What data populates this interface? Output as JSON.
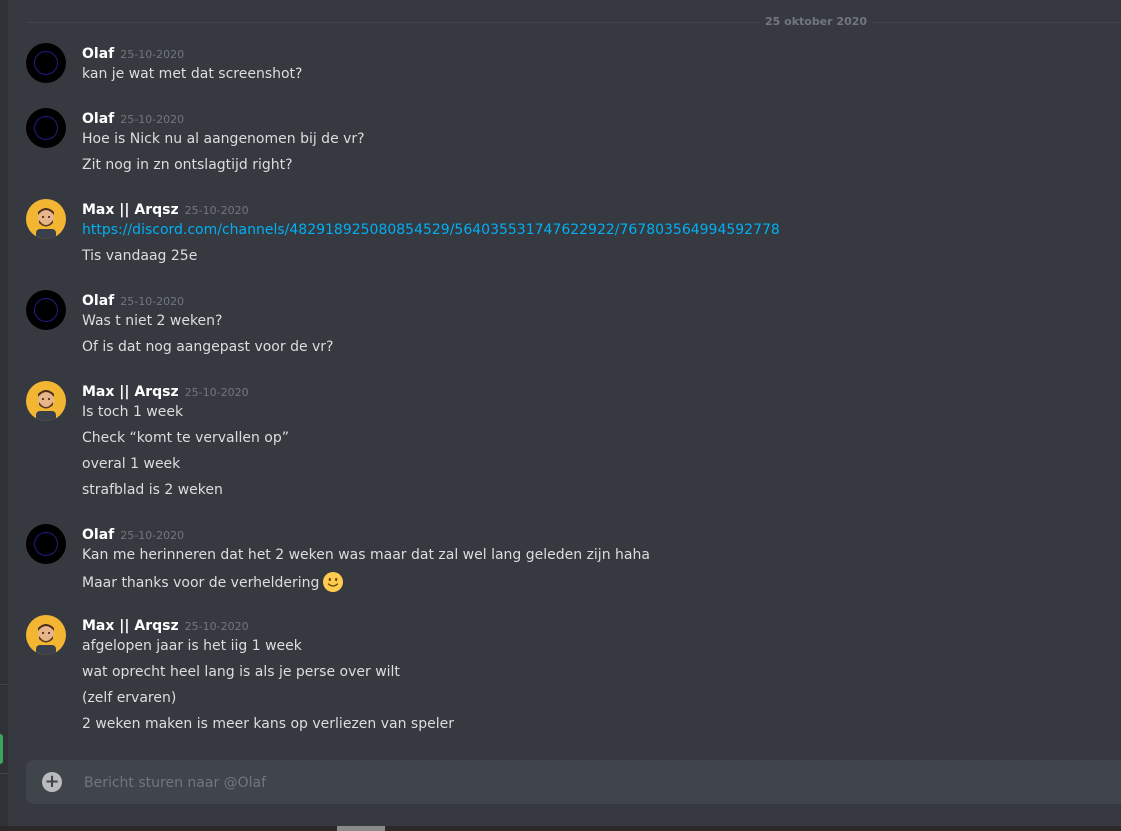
{
  "date_divider": "25 oktober 2020",
  "messages": [
    {
      "author": "Olaf",
      "timestamp": "25-10-2020",
      "avatar": "olaf",
      "lines": [
        "kan je wat met dat screenshot?"
      ]
    },
    {
      "author": "Olaf",
      "timestamp": "25-10-2020",
      "avatar": "olaf",
      "lines": [
        "Hoe is Nick nu al aangenomen bij de vr?",
        "Zit nog in zn ontslagtijd right?"
      ]
    },
    {
      "author": "Max || Arqsz",
      "timestamp": "25-10-2020",
      "avatar": "max",
      "link": "https://discord.com/channels/482918925080854529/564035531747622922/767803564994592778",
      "lines": [
        "Tis vandaag 25e"
      ]
    },
    {
      "author": "Olaf",
      "timestamp": "25-10-2020",
      "avatar": "olaf",
      "lines": [
        "Was t niet 2 weken?",
        "Of is dat nog aangepast voor de vr?"
      ]
    },
    {
      "author": "Max || Arqsz",
      "timestamp": "25-10-2020",
      "avatar": "max",
      "lines": [
        "Is toch 1 week",
        "Check “komt te vervallen op”",
        "overal 1 week",
        "strafblad is 2 weken"
      ]
    },
    {
      "author": "Olaf",
      "timestamp": "25-10-2020",
      "avatar": "olaf",
      "lines": [
        "Kan me herinneren dat het 2 weken was maar dat zal wel lang geleden zijn haha",
        "Maar thanks voor de verheldering"
      ],
      "emoji": "slightly-smiling-face-icon"
    },
    {
      "author": "Max || Arqsz",
      "timestamp": "25-10-2020",
      "avatar": "max",
      "lines": [
        "afgelopen jaar is het iig 1 week",
        "wat oprecht heel lang is als je perse over wilt",
        "(zelf ervaren)",
        "2 weken maken is meer kans op verliezen van speler"
      ]
    }
  ],
  "composer": {
    "placeholder": "Bericht sturen naar @Olaf",
    "add_icon": "plus-circle-icon"
  },
  "colors": {
    "background": "#36393f",
    "link": "#00aff4",
    "author": "#ffffff",
    "timestamp": "#72767d",
    "composer": "#40444b"
  }
}
